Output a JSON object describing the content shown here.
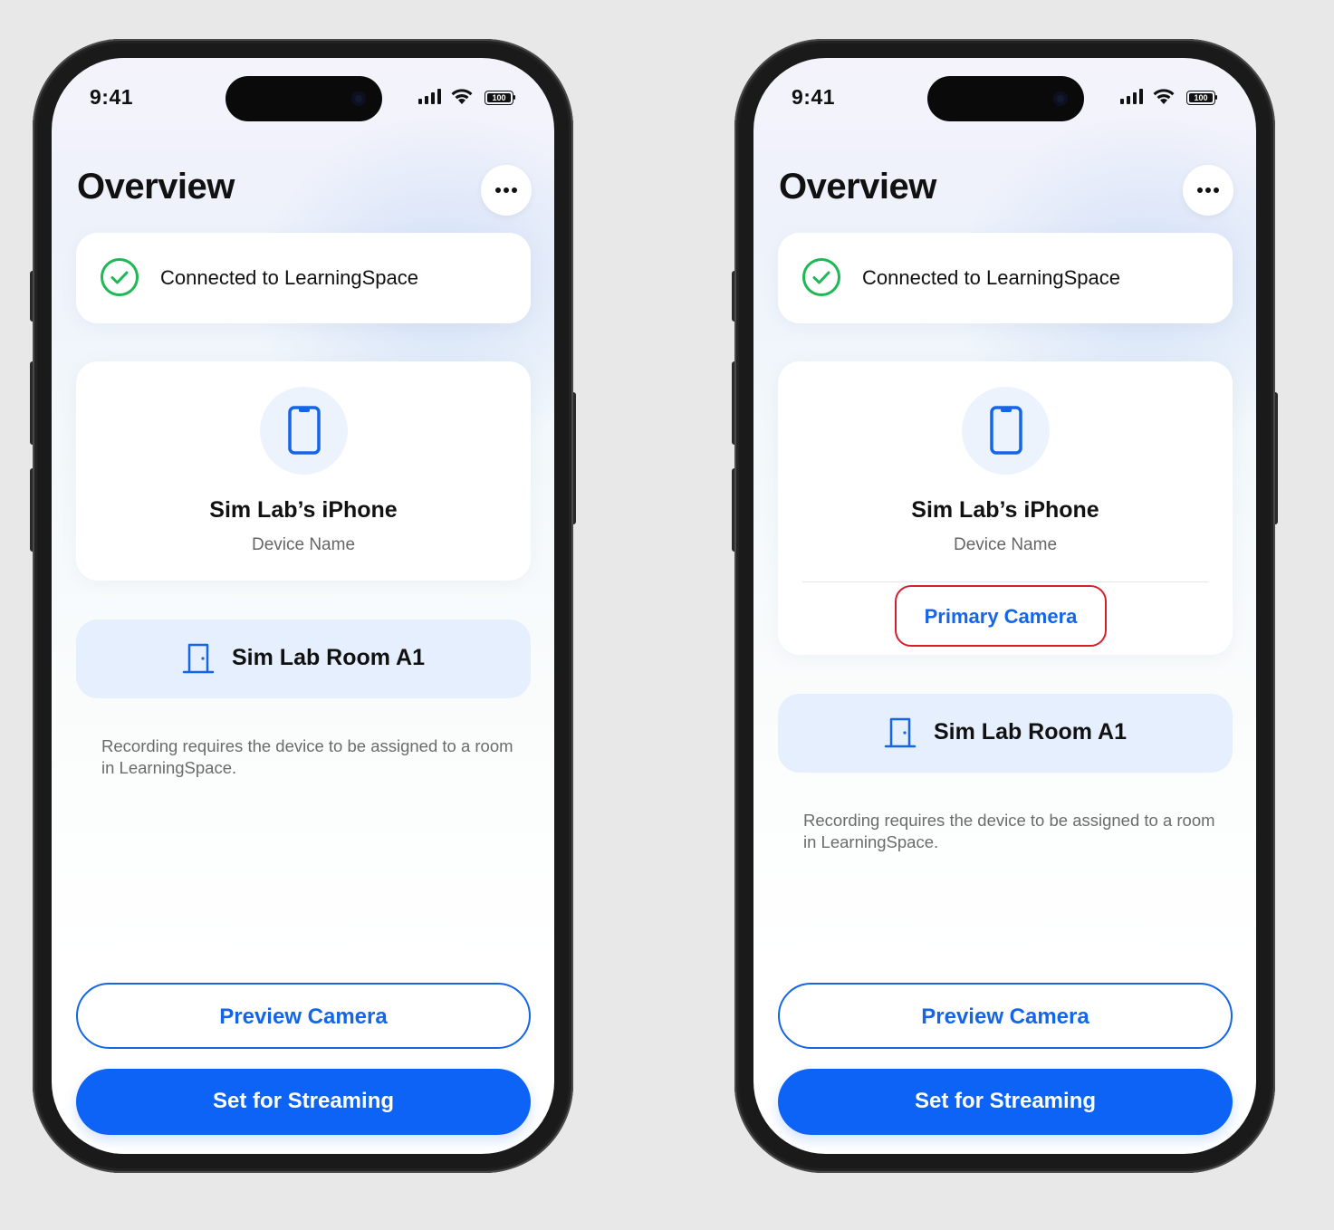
{
  "screens": [
    {
      "status": {
        "time": "9:41",
        "battery": "100"
      },
      "header": {
        "title": "Overview",
        "more_icon": "ellipsis-icon"
      },
      "connection": {
        "text": "Connected to LearningSpace",
        "icon": "check-circle-icon",
        "color": "#1db954"
      },
      "device": {
        "name": "Sim Lab’s iPhone",
        "subtitle": "Device Name",
        "icon": "iphone-icon"
      },
      "room": {
        "name": "Sim Lab Room A1",
        "icon": "door-icon"
      },
      "note": "Recording requires the device to be assigned to a room in LearningSpace.",
      "buttons": {
        "preview": "Preview Camera",
        "stream": "Set for Streaming"
      }
    },
    {
      "status": {
        "time": "9:41",
        "battery": "100"
      },
      "header": {
        "title": "Overview",
        "more_icon": "ellipsis-icon"
      },
      "connection": {
        "text": "Connected to LearningSpace",
        "icon": "check-circle-icon",
        "color": "#1db954"
      },
      "device": {
        "name": "Sim Lab’s iPhone",
        "subtitle": "Device Name",
        "icon": "iphone-icon",
        "role": "Primary Camera"
      },
      "room": {
        "name": "Sim Lab Room A1",
        "icon": "door-icon"
      },
      "note": "Recording requires the device to be assigned to a room in LearningSpace.",
      "buttons": {
        "preview": "Preview Camera",
        "stream": "Set for Streaming"
      }
    }
  ],
  "colors": {
    "accent": "#1565e9",
    "button_fill": "#0d63f5",
    "success": "#1db954",
    "highlight_border": "#d81d2c",
    "room_bg": "#e6effd"
  }
}
